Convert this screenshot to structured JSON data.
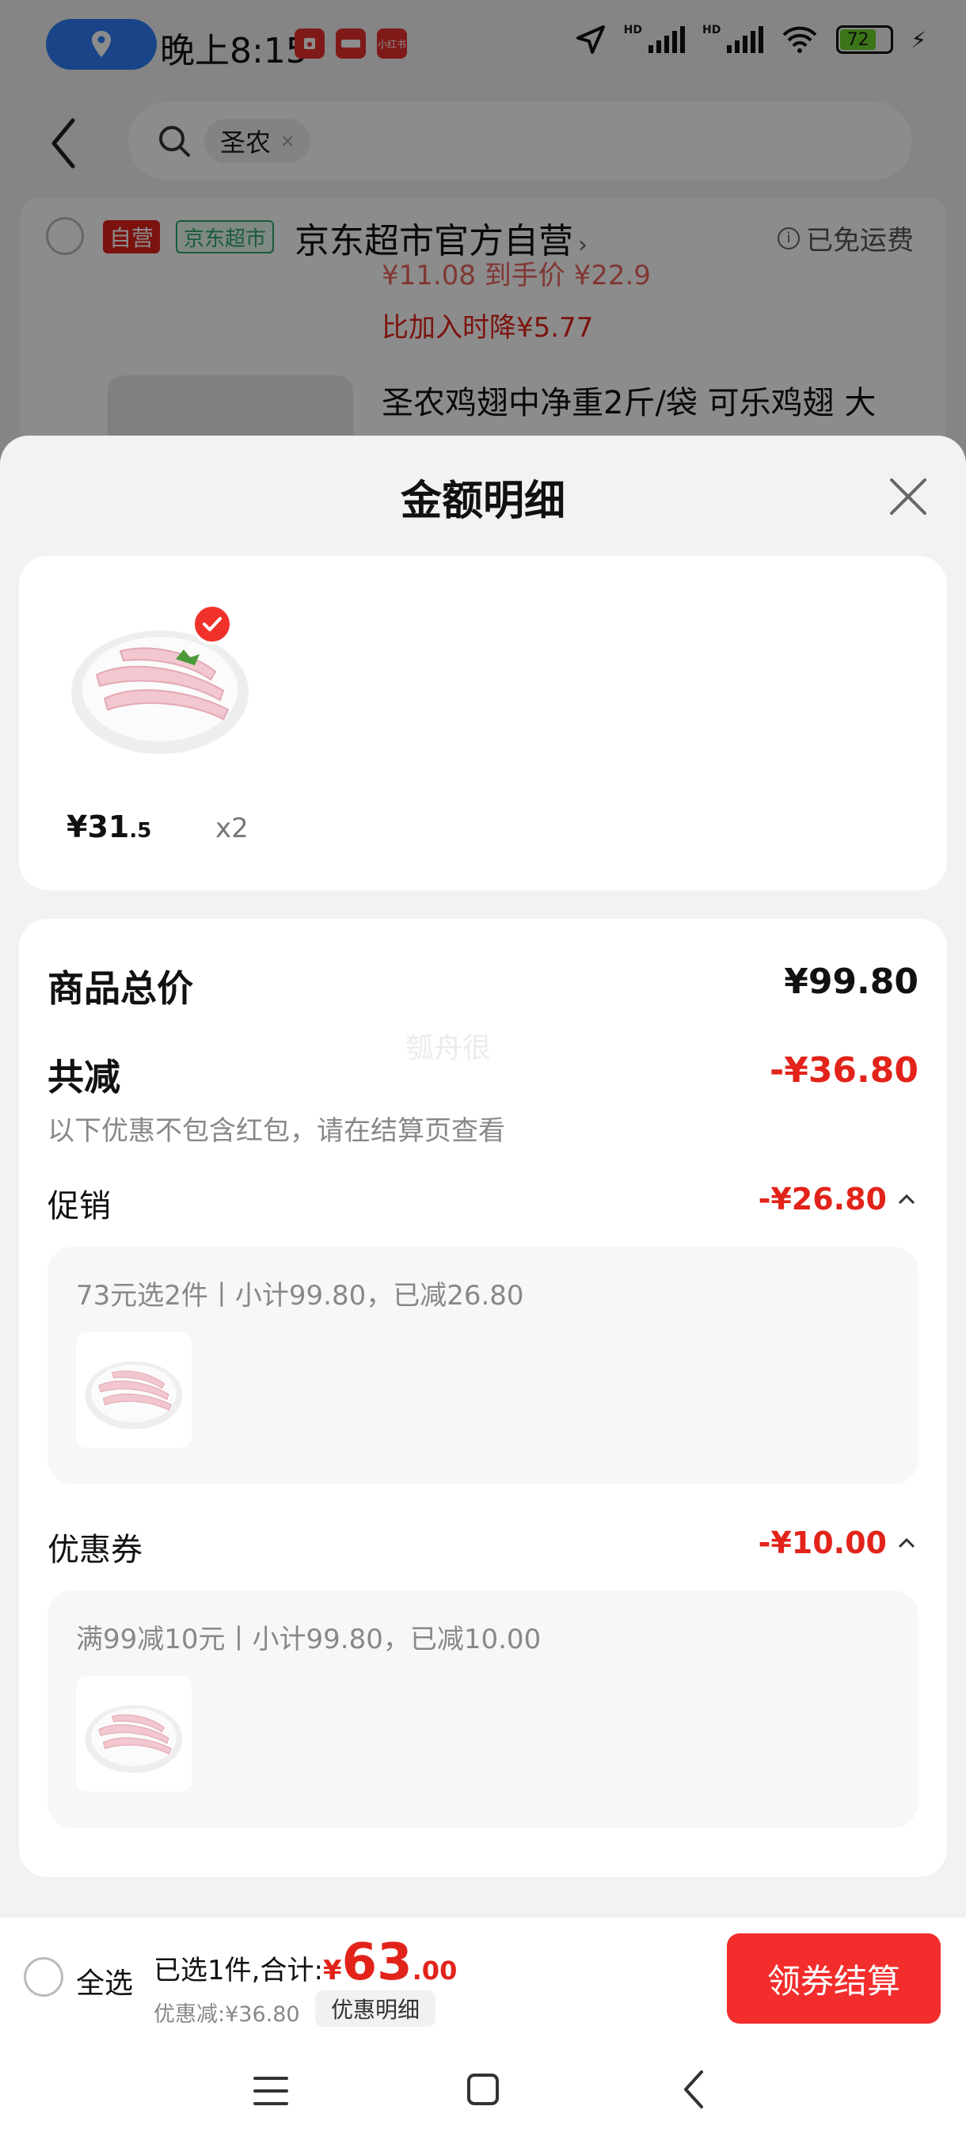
{
  "status_bar": {
    "time": "晚上8:15",
    "battery": "72",
    "apps": [
      "red-envelope-app-icon",
      "news-app-icon",
      "xiaohongshu-app-icon"
    ],
    "app_labels": [
      "",
      "",
      "小红书"
    ]
  },
  "search": {
    "tag": "圣农",
    "tag_close": "×"
  },
  "store": {
    "tag_self": "自营",
    "tag_market": "京东超市",
    "name": "京东超市官方自营",
    "chevron": "›",
    "free_shipping": "已免运费",
    "info_icon": "i"
  },
  "bg_item": {
    "price_partial": "¥11.08 到手价   ¥22.9",
    "price_drop": "比加入时降¥5.77",
    "title": "圣农鸡翅中净重2斤/袋 可乐鸡翅 大"
  },
  "sheet": {
    "title": "金额明细",
    "item": {
      "price_int": "¥31",
      "price_dec": ".5",
      "qty": "x2"
    },
    "total_label": "商品总价",
    "total_value": "¥99.80",
    "watermark": "瓠舟很",
    "save_label": "共减",
    "save_value": "-¥36.80",
    "save_note": "以下优惠不包含红包，请在结算页查看",
    "promo": {
      "label": "促销",
      "value": "-¥26.80",
      "desc": "73元选2件丨小计99.80，已减26.80"
    },
    "coupon": {
      "label": "优惠券",
      "value": "-¥10.00",
      "desc": "满99减10元丨小计99.80，已减10.00"
    }
  },
  "bottom": {
    "select_all": "全选",
    "summary_label": "已选1件,合计:",
    "currency": "¥",
    "total_int": "63",
    "total_dec": ".00",
    "discount": "优惠减:¥36.80",
    "detail_button": "优惠明细",
    "checkout_button": "领券结算"
  },
  "colors": {
    "accent_red": "#e2231a",
    "checkout_red": "#f22d2c",
    "location_blue": "#2f7ef7",
    "green_tag": "#2fa86b"
  }
}
